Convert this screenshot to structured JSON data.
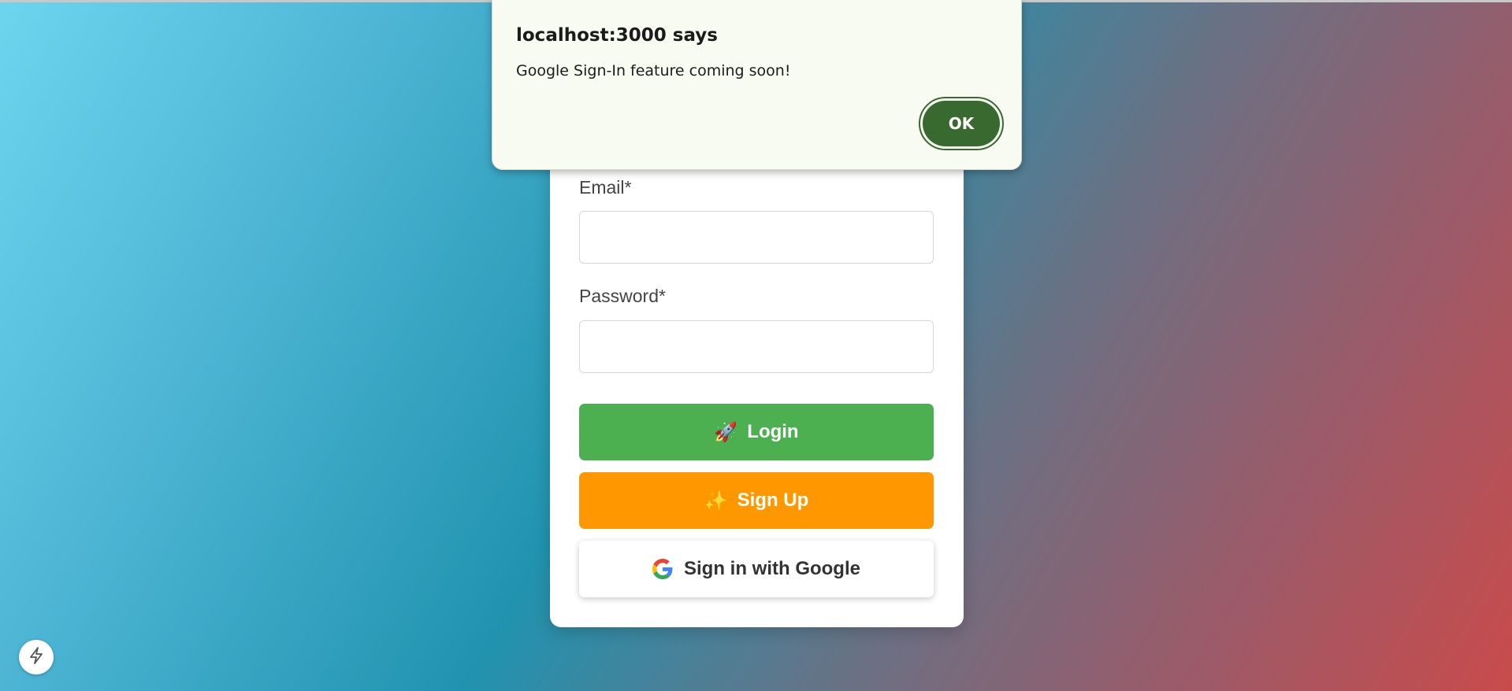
{
  "dialog": {
    "title": "localhost:3000 says",
    "message": "Google Sign-In feature coming soon!",
    "ok_label": "OK"
  },
  "form": {
    "email_label": "Email*",
    "email_value": "",
    "password_label": "Password*",
    "password_value": "",
    "login_label": "Login",
    "login_emoji": "🚀",
    "signup_label": "Sign Up",
    "signup_emoji": "✨",
    "google_label": "Sign in with Google"
  },
  "icons": {
    "google": "google-g-icon",
    "rocket": "rocket-icon",
    "sparkles": "sparkles-icon",
    "bolt": "lightning-bolt-icon"
  },
  "colors": {
    "login_button": "#4caf50",
    "signup_button": "#ff9800",
    "dialog_ok": "#386a30",
    "dialog_bg": "#f8fbf1"
  }
}
